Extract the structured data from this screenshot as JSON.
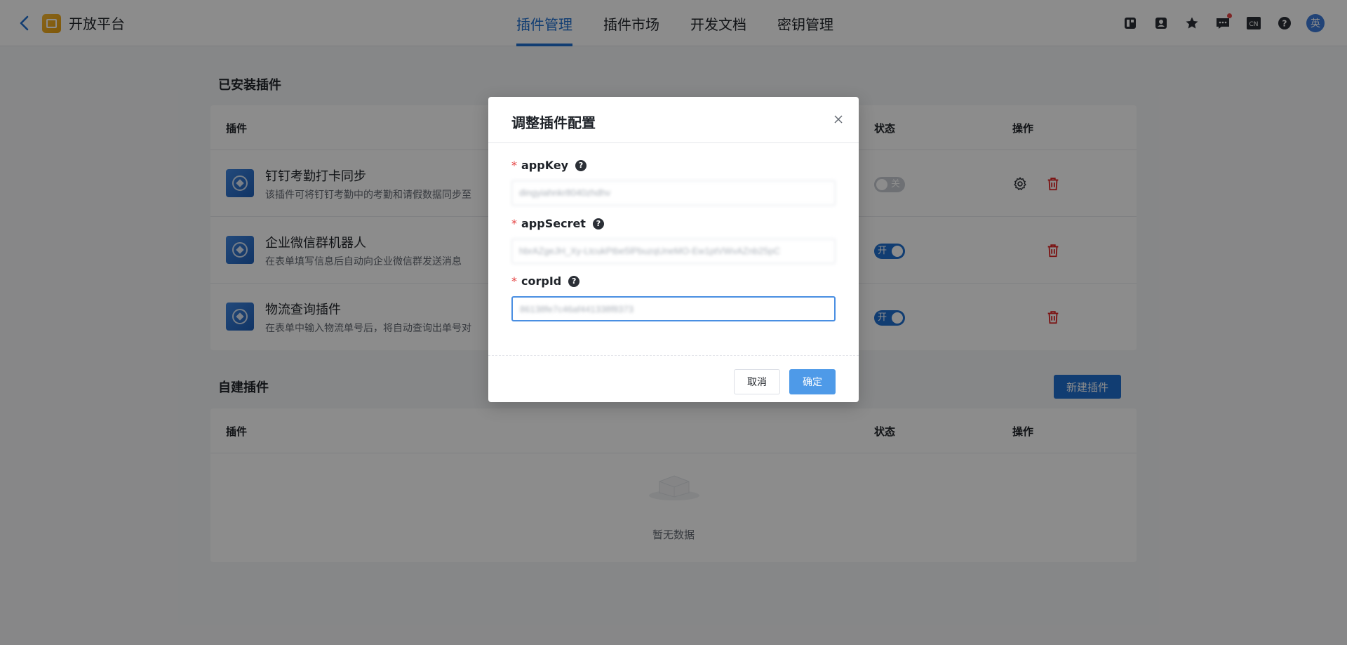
{
  "header": {
    "app_title": "开放平台",
    "tabs": [
      {
        "label": "插件管理",
        "active": true
      },
      {
        "label": "插件市场",
        "active": false
      },
      {
        "label": "开发文档",
        "active": false
      },
      {
        "label": "密钥管理",
        "active": false
      }
    ],
    "avatar_text": "英",
    "lang_text": "CN",
    "accent_color": "#1f6fd0"
  },
  "installed": {
    "title": "已安装插件",
    "columns": {
      "plugin": "插件",
      "status": "状态",
      "action": "操作"
    },
    "rows": [
      {
        "name": "钉钉考勤打卡同步",
        "desc": "该插件可将钉钉考勤中的考勤和请假数据同步至",
        "switch_label": "关",
        "enabled": false
      },
      {
        "name": "企业微信群机器人",
        "desc": "在表单填写信息后自动向企业微信群发送消息",
        "switch_label": "开",
        "enabled": true
      },
      {
        "name": "物流查询插件",
        "desc": "在表单中输入物流单号后，将自动查询出单号对",
        "switch_label": "开",
        "enabled": true
      }
    ]
  },
  "custom": {
    "title": "自建插件",
    "new_button": "新建插件",
    "columns": {
      "plugin": "插件",
      "status": "状态",
      "action": "操作"
    },
    "empty_text": "暂无数据"
  },
  "modal": {
    "title": "调整插件配置",
    "fields": [
      {
        "label": "appKey",
        "value": "dingyiahnkr8040zhdhv"
      },
      {
        "label": "appSecret",
        "value": "hbrAZgeJH_Xy-LtcukPtbe5lPbuzqUneMO-Ew1ptVWvAZnb25pC"
      },
      {
        "label": "corpId",
        "value": "86138fe7c46af441338f8373"
      }
    ],
    "help_glyph": "?",
    "required_mark": "*",
    "cancel_label": "取消",
    "ok_label": "确定"
  }
}
